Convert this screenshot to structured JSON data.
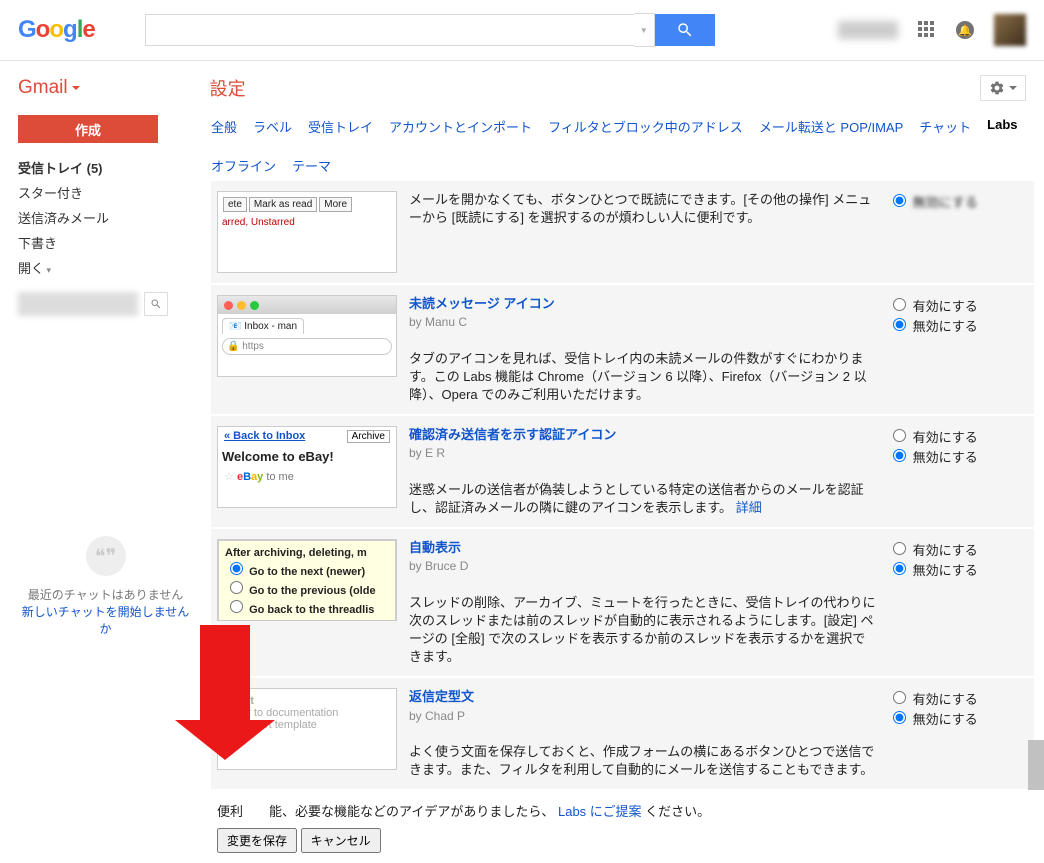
{
  "header": {
    "logo_letters": [
      "G",
      "o",
      "o",
      "g",
      "l",
      "e"
    ],
    "search_placeholder": "",
    "gmail_label": "Gmail",
    "page_title": "設定"
  },
  "sidebar": {
    "compose": "作成",
    "items": [
      {
        "label": "受信トレイ (5)",
        "bold": true
      },
      {
        "label": "スター付き",
        "bold": false
      },
      {
        "label": "送信済みメール",
        "bold": false
      },
      {
        "label": "下書き",
        "bold": false
      },
      {
        "label": "開く",
        "bold": false,
        "dropdown": true
      }
    ],
    "hangouts_empty": "最近のチャットはありません",
    "hangouts_link": "新しいチャットを開始しませんか"
  },
  "tabs": [
    {
      "label": "全般",
      "active": false
    },
    {
      "label": "ラベル",
      "active": false
    },
    {
      "label": "受信トレイ",
      "active": false
    },
    {
      "label": "アカウントとインポート",
      "active": false
    },
    {
      "label": "フィルタとブロック中のアドレス",
      "active": false
    },
    {
      "label": "メール転送と POP/IMAP",
      "active": false
    },
    {
      "label": "チャット",
      "active": false
    },
    {
      "label": "Labs",
      "active": true
    },
    {
      "label": "オフライン",
      "active": false
    },
    {
      "label": "テーマ",
      "active": false
    }
  ],
  "opt_enable": "有効にする",
  "opt_disable": "無効にする",
  "labs": [
    {
      "title": "",
      "by": "",
      "desc": "メールを開かなくても、ボタンひとつで既読にできます。[その他の操作] メニューから [既読にする] を選択するのが煩わしい人に便利です。",
      "thumb": "markread",
      "thumb_text": {
        "btn1": "ete",
        "btn2": "Mark as read",
        "btn3": "More",
        "line": "arred, Unstarred"
      }
    },
    {
      "title": "未読メッセージ アイコン",
      "by": "by Manu C",
      "desc": "タブのアイコンを見れば、受信トレイ内の未読メールの件数がすぐにわかります。この Labs 機能は Chrome（バージョン 6 以降）、Firefox（バージョン 2 以降）、Opera でのみご利用いただけます。",
      "thumb": "browser",
      "thumb_text": {
        "tab": "Inbox - man",
        "url": "https"
      }
    },
    {
      "title": "確認済み送信者を示す認証アイコン",
      "by": "by E R",
      "desc": "迷惑メールの送信者が偽装しようとしている特定の送信者からのメールを認証し、認証済みメールの隣に鍵のアイコンを表示します。",
      "desc_link": "詳細",
      "thumb": "ebay",
      "thumb_text": {
        "back": "« Back to Inbox",
        "archive": "Archive",
        "welcome": "Welcome to eBay!",
        "tome": "to me"
      }
    },
    {
      "title": "自動表示",
      "by": "by Bruce D",
      "desc": "スレッドの削除、アーカイブ、ミュートを行ったときに、受信トレイの代わりに次のスレッドまたは前のスレッドが自動的に表示されるようにします。[設定] ページの [全般] で次のスレッドを表示するか前のスレッドを表示するかを選択できます。",
      "thumb": "autoadvance",
      "thumb_text": {
        "head": "After archiving, deleting, m",
        "o1": "Go to the next (newer)",
        "o2": "Go to the previous (olde",
        "o3": "Go back to the threadlis"
      }
    },
    {
      "title": "返信定型文",
      "by": "by Chad P",
      "desc": "よく使う文面を保存しておくと、作成フォームの横にあるボタンひとつで送信できます。また、フィルタを利用して自動的にメールを送信することもできます。",
      "thumb": "canned",
      "thumb_text": {
        "ins": "Insert",
        "l1": "Refer to documentation",
        "l2": "ort template"
      }
    }
  ],
  "footer": {
    "text_before": "便利　　能、必要な機能などのアイデアがありましたら、",
    "link": "Labs にご提案",
    "text_after": "ください。",
    "save": "変更を保存",
    "cancel": "キャンセル"
  }
}
